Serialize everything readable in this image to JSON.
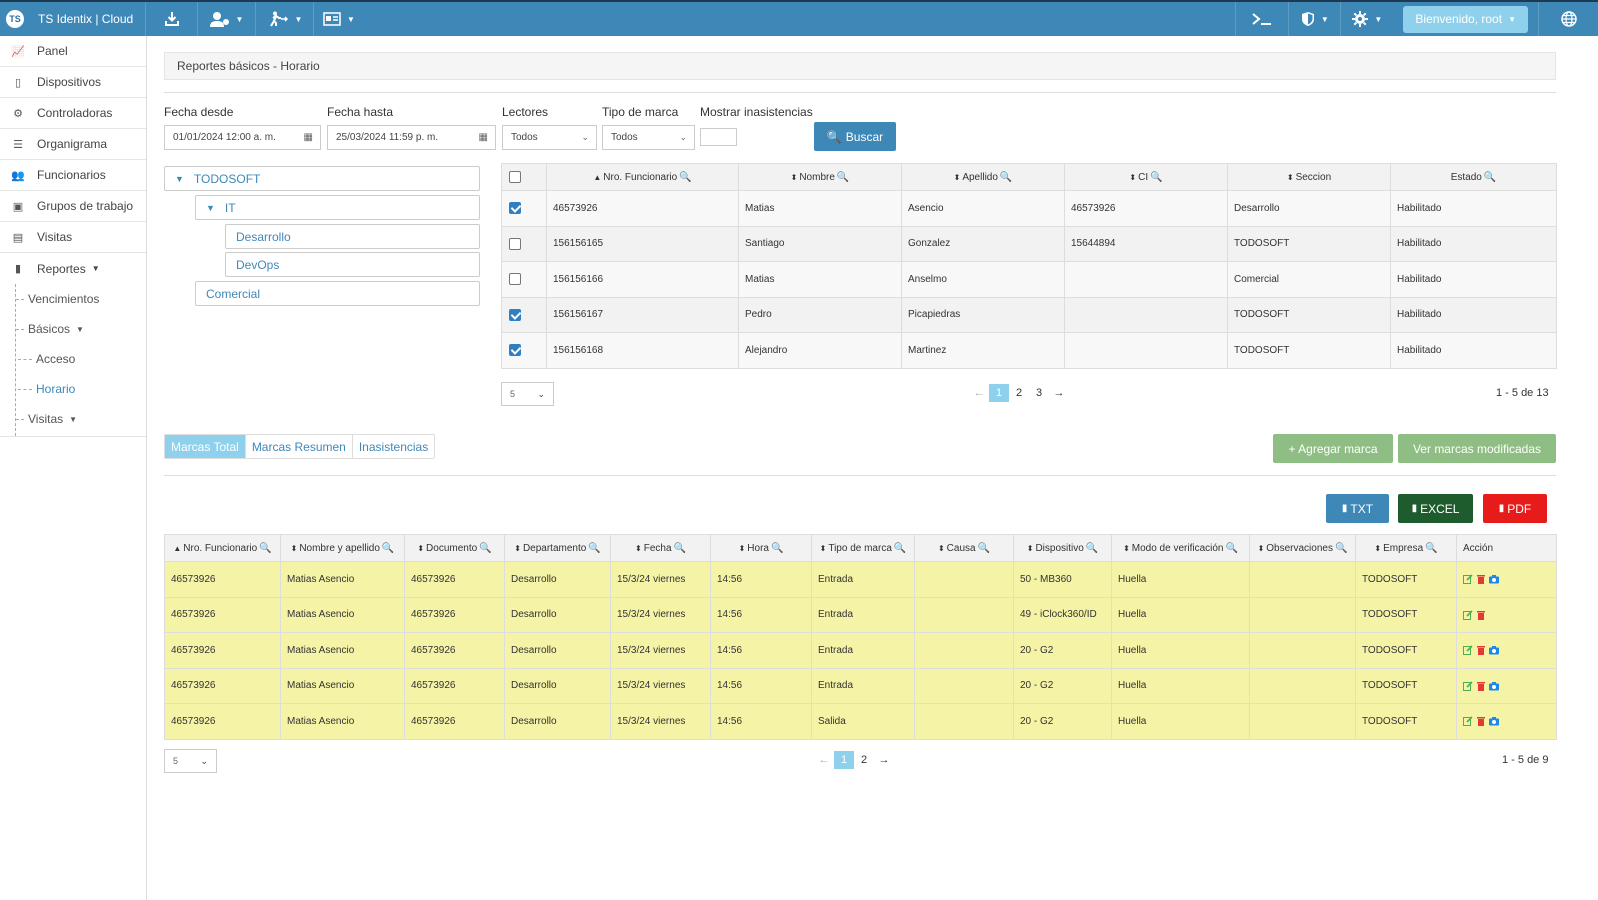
{
  "topbar": {
    "logo": "TS",
    "title": "TS Identix | Cloud",
    "welcome": "Bienvenido, root"
  },
  "sidebar": {
    "items": [
      {
        "label": "Panel",
        "icon": "chart-icon"
      },
      {
        "label": "Dispositivos",
        "icon": "tablet-icon"
      },
      {
        "label": "Controladoras",
        "icon": "cog-icon"
      },
      {
        "label": "Organigrama",
        "icon": "list-icon"
      },
      {
        "label": "Funcionarios",
        "icon": "users-icon"
      },
      {
        "label": "Grupos de trabajo",
        "icon": "group-icon"
      },
      {
        "label": "Visitas",
        "icon": "id-card-icon"
      },
      {
        "label": "Reportes",
        "icon": "file-icon"
      }
    ],
    "reportes_sub": {
      "vencimientos": "Vencimientos",
      "basicos": "Básicos",
      "acceso": "Acceso",
      "horario": "Horario",
      "visitas": "Visitas"
    }
  },
  "page": {
    "title": "Reportes básicos - Horario"
  },
  "filters": {
    "fecha_desde_label": "Fecha desde",
    "fecha_desde_value": "01/01/2024 12:00 a. m.",
    "fecha_hasta_label": "Fecha hasta",
    "fecha_hasta_value": "25/03/2024 11:59 p. m.",
    "lectores_label": "Lectores",
    "lectores_value": "Todos",
    "tipo_marca_label": "Tipo de marca",
    "tipo_marca_value": "Todos",
    "mostrar_label": "Mostrar inasistencias",
    "buscar": "Buscar"
  },
  "tree": {
    "root": "TODOSOFT",
    "it": "IT",
    "desarrollo": "Desarrollo",
    "devops": "DevOps",
    "comercial": "Comercial"
  },
  "employees": {
    "headers": [
      "Nro. Funcionario",
      "Nombre",
      "Apellido",
      "CI",
      "Seccion",
      "Estado"
    ],
    "rows": [
      {
        "checked": true,
        "cells": [
          "46573926",
          "Matias",
          "Asencio",
          "46573926",
          "Desarrollo",
          "Habilitado"
        ]
      },
      {
        "checked": false,
        "cells": [
          "156156165",
          "Santiago",
          "Gonzalez",
          "15644894",
          "TODOSOFT",
          "Habilitado"
        ]
      },
      {
        "checked": false,
        "cells": [
          "156156166",
          "Matias",
          "Anselmo",
          "",
          "Comercial",
          "Habilitado"
        ]
      },
      {
        "checked": true,
        "cells": [
          "156156167",
          "Pedro",
          "Picapiedras",
          "",
          "TODOSOFT",
          "Habilitado"
        ]
      },
      {
        "checked": true,
        "cells": [
          "156156168",
          "Alejandro",
          "Martinez",
          "",
          "TODOSOFT",
          "Habilitado"
        ]
      }
    ],
    "page_size": "5",
    "pages": [
      "1",
      "2",
      "3"
    ],
    "count": "1 - 5 de 13"
  },
  "tabs": [
    "Marcas Total",
    "Marcas Resumen",
    "Inasistencias"
  ],
  "actions": {
    "agregar": "+ Agregar marca",
    "ver": "Ver marcas modificadas",
    "txt": "TXT",
    "excel": "EXCEL",
    "pdf": "PDF"
  },
  "marks": {
    "headers": [
      "Nro. Funcionario",
      "Nombre y apellido",
      "Documento",
      "Departamento",
      "Fecha",
      "Hora",
      "Tipo de marca",
      "Causa",
      "Dispositivo",
      "Modo de verificación",
      "Observaciones",
      "Empresa",
      "Acción"
    ],
    "rows": [
      {
        "cells": [
          "46573926",
          "Matias Asencio",
          "46573926",
          "Desarrollo",
          "15/3/24 viernes",
          "14:56",
          "Entrada",
          "",
          "50 - MB360",
          "Huella",
          "",
          "TODOSOFT"
        ],
        "camera": true
      },
      {
        "cells": [
          "46573926",
          "Matias Asencio",
          "46573926",
          "Desarrollo",
          "15/3/24 viernes",
          "14:56",
          "Entrada",
          "",
          "49 - iClock360/ID",
          "Huella",
          "",
          "TODOSOFT"
        ],
        "camera": false
      },
      {
        "cells": [
          "46573926",
          "Matias Asencio",
          "46573926",
          "Desarrollo",
          "15/3/24 viernes",
          "14:56",
          "Entrada",
          "",
          "20 - G2",
          "Huella",
          "",
          "TODOSOFT"
        ],
        "camera": true
      },
      {
        "cells": [
          "46573926",
          "Matias Asencio",
          "46573926",
          "Desarrollo",
          "15/3/24 viernes",
          "14:56",
          "Entrada",
          "",
          "20 - G2",
          "Huella",
          "",
          "TODOSOFT"
        ],
        "camera": true
      },
      {
        "cells": [
          "46573926",
          "Matias Asencio",
          "46573926",
          "Desarrollo",
          "15/3/24 viernes",
          "14:56",
          "Salida",
          "",
          "20 - G2",
          "Huella",
          "",
          "TODOSOFT"
        ],
        "camera": true
      }
    ],
    "page_size": "5",
    "pages": [
      "1",
      "2"
    ],
    "count": "1 - 5 de 9"
  },
  "colors": {
    "topbar": "#3e88b8",
    "accent": "#8fd1ec",
    "row_highlight": "#f5f3a6",
    "green_button": "#8fbe84",
    "excel": "#1e5c2e",
    "pdf": "#e81b1b",
    "txt": "#3e88b8"
  }
}
